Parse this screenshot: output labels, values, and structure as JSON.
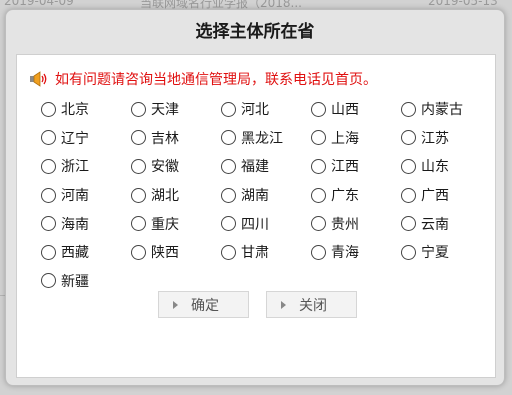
{
  "background": {
    "strip_left": "2019-04-09",
    "strip_middle": "当联网域名行业学报（2018...",
    "strip_right": "2019-05-13"
  },
  "dialog": {
    "title": "选择主体所在省",
    "notice": "如有问题请咨询当地通信管理局，联系电话见首页。",
    "speaker_icon": "speaker-icon",
    "accent_color": "#e01010",
    "provinces": [
      [
        "北京",
        "天津",
        "河北",
        "山西",
        "内蒙古"
      ],
      [
        "辽宁",
        "吉林",
        "黑龙江",
        "上海",
        "江苏"
      ],
      [
        "浙江",
        "安徽",
        "福建",
        "江西",
        "山东"
      ],
      [
        "河南",
        "湖北",
        "湖南",
        "广东",
        "广西"
      ],
      [
        "海南",
        "重庆",
        "四川",
        "贵州",
        "云南"
      ],
      [
        "西藏",
        "陕西",
        "甘肃",
        "青海",
        "宁夏"
      ],
      [
        "新疆"
      ]
    ],
    "buttons": {
      "ok_label": "确定",
      "close_label": "关闭"
    }
  }
}
